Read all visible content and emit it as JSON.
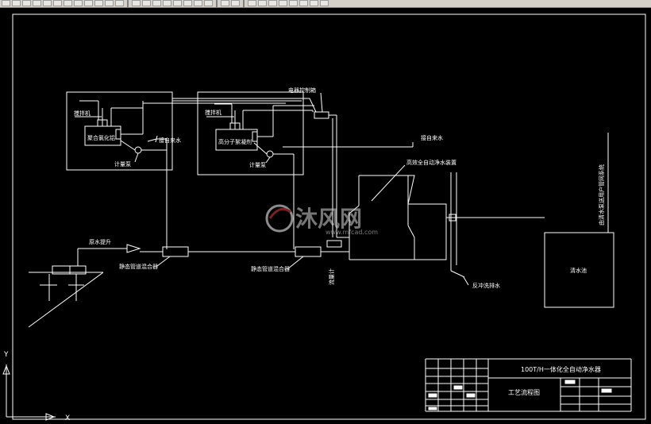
{
  "toolbar": {
    "buttons": [
      "new-icon",
      "open-icon",
      "save-icon",
      "print-icon",
      "preview-icon",
      "publish-icon",
      "cut-icon",
      "copy-icon",
      "paste-icon",
      "match-icon",
      "undo-icon",
      "redo-icon",
      "pan-icon",
      "zoom-realtime-icon",
      "zoom-window-icon",
      "zoom-previous-icon",
      "properties-icon",
      "design-center-icon",
      "tool-palettes-icon",
      "sheet-set-icon",
      "markup-icon",
      "calc-icon",
      "layer-icon",
      "layer-state-icon",
      "layer-prev-icon",
      "color-icon",
      "linetype-icon",
      "lineweight-icon",
      "plot-style-icon",
      "help-icon"
    ]
  },
  "diagram": {
    "labels": {
      "electric_cabinet": "电器控制箱",
      "doser1": "搅拌机",
      "tank1": "聚合氯化铝",
      "meter1": "计量泵",
      "to_tap_water1": "接自来水",
      "doser2": "搅拌机",
      "tank2": "高分子絮凝剂",
      "meter2": "计量泵",
      "to_tap_water2": "接自来水",
      "purifier": "高效全自动净水装置",
      "raw_pump": "原水提升",
      "mixer1": "静态管道混合器",
      "mixer2": "静态管道混合器",
      "backwash": "反冲洗排水",
      "flow_meter": "流量计",
      "clear_pool": "清水池",
      "to_user": "由清水泵送用户管网系统"
    },
    "watermark": {
      "text": "沐风网",
      "url": "www.mfcad.com"
    },
    "title_block": {
      "project": "100T/H一体化全自动净水器",
      "drawing_name": "工艺流程图"
    },
    "ucs": {
      "y": "Y",
      "x": "X"
    }
  }
}
